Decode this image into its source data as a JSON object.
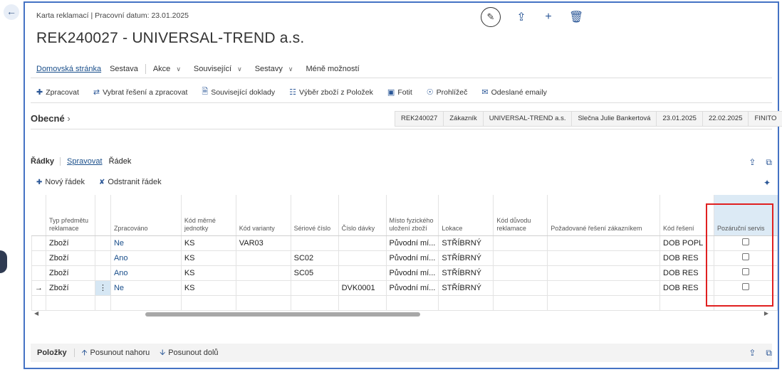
{
  "breadcrumb": "Karta reklamací | Pracovní datum: 23.01.2025",
  "title": "REK240027 - UNIVERSAL-TREND a.s.",
  "menu": {
    "home": "Domovská stránka",
    "report": "Sestava",
    "actions": "Akce",
    "related": "Související",
    "reports": "Sestavy",
    "fewer": "Méně možností"
  },
  "actions": {
    "process": "Zpracovat",
    "select_process": "Vybrat řešení a zpracovat",
    "related_docs": "Související doklady",
    "select_items": "Výběr zboží z Položek",
    "photo": "Fotit",
    "viewer": "Prohlížeč",
    "sent_emails": "Odeslané emaily"
  },
  "general": {
    "title": "Obecné",
    "summary": [
      "REK240027",
      "Zákazník",
      "UNIVERSAL-TREND a.s.",
      "Slečna Julie Bankertová",
      "23.01.2025",
      "22.02.2025",
      "FINITO"
    ]
  },
  "lines": {
    "label": "Řádky",
    "tab_manage": "Spravovat",
    "tab_line": "Řádek",
    "new_line": "Nový řádek",
    "delete_line": "Odstranit řádek",
    "columns": {
      "type": "Typ předmětu reklamace",
      "processed": "Zpracováno",
      "uom": "Kód měrné jednotky",
      "variant": "Kód varianty",
      "serial": "Sériové číslo",
      "lot": "Číslo dávky",
      "location_physical": "Místo fyzického uložení zboží",
      "location": "Lokace",
      "reason": "Kód důvodu reklamace",
      "requested": "Požadované řešení zákazníkem",
      "solution": "Kód řešení",
      "warranty": "Pozáruční servis"
    },
    "rows": [
      {
        "type": "Zboží",
        "processed": "Ne",
        "uom": "KS",
        "variant": "VAR03",
        "serial": "",
        "lot": "",
        "loc_phys": "Původní mí...",
        "location": "STŘÍBRNÝ",
        "reason": "",
        "requested": "",
        "solution": "DOB POPL",
        "warranty": false
      },
      {
        "type": "Zboží",
        "processed": "Ano",
        "uom": "KS",
        "variant": "",
        "serial": "SC02",
        "lot": "",
        "loc_phys": "Původní mí...",
        "location": "STŘÍBRNÝ",
        "reason": "",
        "requested": "",
        "solution": "DOB RES",
        "warranty": false
      },
      {
        "type": "Zboží",
        "processed": "Ano",
        "uom": "KS",
        "variant": "",
        "serial": "SC05",
        "lot": "",
        "loc_phys": "Původní mí...",
        "location": "STŘÍBRNÝ",
        "reason": "",
        "requested": "",
        "solution": "DOB RES",
        "warranty": false
      },
      {
        "type": "Zboží",
        "processed": "Ne",
        "uom": "KS",
        "variant": "",
        "serial": "",
        "lot": "DVK0001",
        "loc_phys": "Původní mí...",
        "location": "STŘÍBRNÝ",
        "reason": "",
        "requested": "",
        "solution": "DOB RES",
        "warranty": false
      }
    ]
  },
  "items_section": {
    "label": "Položky",
    "move_up": "Posunout nahoru",
    "move_down": "Posunout dolů"
  }
}
